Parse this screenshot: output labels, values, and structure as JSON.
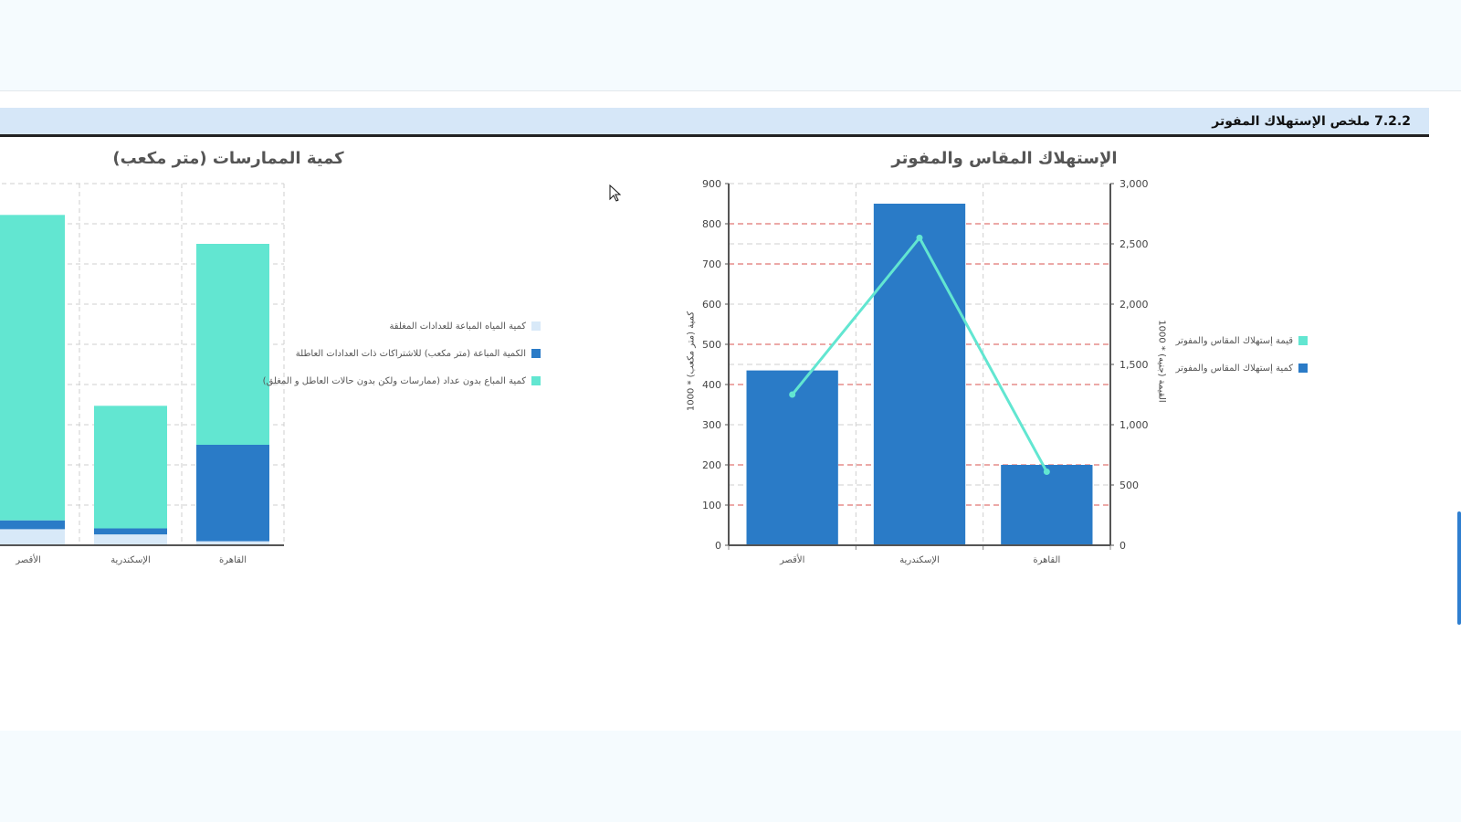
{
  "section": {
    "title": "7.2.2 ملخص الإستهلاك المفوتر"
  },
  "colors": {
    "teal": "#62e6d1",
    "blue": "#2a7bc7",
    "light": "#d8e9f8"
  },
  "charts": {
    "left": {
      "title": "كمية الممارسات (متر مكعب)",
      "legend": [
        {
          "label": "كمية المياه المباعة للعدادات المغلقة",
          "color": "#d8e9f8"
        },
        {
          "label": "الكمية المباعة (متر مكعب) للاشتراكات  ذات العدادات العاطلة",
          "color": "#2a7bc7"
        },
        {
          "label": "كمية المباع بدون عداد (ممارسات ولكن بدون حالات العاطل و المغلق)",
          "color": "#62e6d1"
        }
      ]
    },
    "right": {
      "title": "الإستهلاك المقاس والمفوتر",
      "y_left_label": "كمية (متر مكعب) * 1000",
      "y_right_label": "القيمة (جنيه) * 1000",
      "legend": [
        {
          "label": "قيمة إستهلاك المقاس والمفوتر",
          "color": "#62e6d1"
        },
        {
          "label": "كمية إستهلاك المقاس والمفوتر",
          "color": "#2a7bc7"
        }
      ]
    }
  },
  "chart_data": [
    {
      "type": "bar",
      "stacked": true,
      "title": "كمية الممارسات (متر مكعب)",
      "categories": [
        "الأقصر",
        "الإسكندرية",
        "القاهرة"
      ],
      "ylim": [
        0,
        900
      ],
      "grid": true,
      "legend_position": "right",
      "series": [
        {
          "name": "كمية المياه المباعة للعدادات المغلقة",
          "color": "#d8e9f8",
          "values": [
            40,
            27,
            10
          ]
        },
        {
          "name": "الكمية المباعة (متر مكعب) للاشتراكات  ذات العدادات العاطلة",
          "color": "#2a7bc7",
          "values": [
            22,
            15,
            240
          ]
        },
        {
          "name": "كمية المباع بدون عداد (ممارسات ولكن بدون حالات العاطل و المغلق)",
          "color": "#62e6d1",
          "values": [
            760,
            305,
            500
          ]
        }
      ]
    },
    {
      "type": "bar",
      "title": "الإستهلاك المقاس والمفوتر",
      "categories": [
        "الأقصر",
        "الإسكندرية",
        "القاهرة"
      ],
      "ylabel": "كمية (متر مكعب) * 1000",
      "y2label": "القيمة (جنيه) * 1000",
      "ylim": [
        0,
        900
      ],
      "y_ticks": [
        0,
        100,
        200,
        300,
        400,
        500,
        600,
        700,
        800,
        900
      ],
      "y2lim": [
        0,
        3000
      ],
      "y2_ticks": [
        "0",
        "500",
        "1,000",
        "1,500",
        "2,000",
        "2,500",
        "3,000"
      ],
      "grid": true,
      "legend_position": "right",
      "series": [
        {
          "name": "كمية إستهلاك المقاس والمفوتر",
          "type": "bar",
          "axis": "left",
          "color": "#2a7bc7",
          "values": [
            435,
            850,
            200
          ]
        },
        {
          "name": "قيمة إستهلاك المقاس والمفوتر",
          "type": "line",
          "axis": "right",
          "color": "#62e6d1",
          "values": [
            1250,
            2550,
            610
          ]
        }
      ]
    }
  ]
}
